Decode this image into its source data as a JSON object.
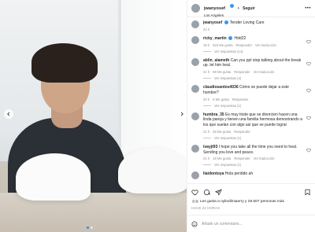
{
  "post": {
    "author": "jwanyosef",
    "location": "Los Angeles",
    "follow_separator": "•",
    "follow_label": "Seguir",
    "more_label": "•••"
  },
  "caption": {
    "author": "jwanyosef",
    "text": "Tender Loving Care",
    "time": "22 h"
  },
  "comments": [
    {
      "author": "ricky_martin",
      "text": "Hdd22",
      "time": "19 h",
      "likes": "922 Me gusta",
      "reply": "Responder",
      "translate": "Ver traducción",
      "replies_label": "Ver respuestas (14)"
    },
    {
      "author": "ablin_alameth",
      "text": "Can you ppl stop talking about the break up. let him heal.",
      "time": "21 h",
      "likes": "98 Me gusta",
      "reply": "Responder",
      "translate": "Ver traducción",
      "replies_label": "Ver respuestas (4)"
    },
    {
      "author": "claudiosantos4036",
      "text": "Cómo se puede dejar a este hombre?",
      "time": "20 h",
      "likes": "6 Me gusta",
      "reply": "Responder",
      "translate": "",
      "replies_label": "Ver respuestas (1)"
    },
    {
      "author": "humbra_35",
      "text": "Es muy triste que se divorcien hacen una linda pareja y tienen una familia hermosa demostrando a los que suelan con algo asi que se puede lograr",
      "time": "21 h",
      "likes": "28 Me gusta",
      "reply": "Responder",
      "translate": "",
      "replies_label": "Ver respuestas (1)"
    },
    {
      "author": "ivayjt93",
      "text": "I hope you take all the time you need to heal. Sending you love and peace.",
      "time": "21 h",
      "likes": "18 Me gusta",
      "reply": "Responder",
      "translate": "Ver traducción",
      "replies_label": "Ver respuestas (1)"
    },
    {
      "author": "liaidontoya",
      "text": "Hola perdido ah",
      "time": "",
      "likes": "",
      "reply": "",
      "translate": "",
      "replies_label": ""
    }
  ],
  "footer": {
    "likes_text": "Les gusta a nyliedlmiaerry y 29.507 personas más",
    "date": "HACE 22 HORAS",
    "add_comment_placeholder": "Añade un comentario..."
  },
  "icons": {
    "prev": "chevron-left-icon",
    "next": "chevron-right-icon",
    "like": "heart-icon",
    "comment": "comment-icon",
    "share": "paper-plane-icon",
    "save": "bookmark-icon",
    "emoji": "smile-icon",
    "more": "more-dots-icon"
  },
  "colors": {
    "accent": "#3897f0",
    "text": "#262626",
    "muted": "#8e8e8e"
  }
}
